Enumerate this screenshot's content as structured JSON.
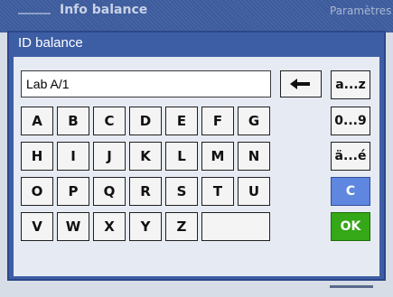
{
  "background": {
    "title_left": "Info balance",
    "title_right": "Paramètres"
  },
  "dialog": {
    "title": "ID balance",
    "input_value": "Lab A/1"
  },
  "keys": [
    [
      "A",
      "B",
      "C",
      "D",
      "E",
      "F",
      "G"
    ],
    [
      "H",
      "I",
      "J",
      "K",
      "L",
      "M",
      "N"
    ],
    [
      "O",
      "P",
      "Q",
      "R",
      "S",
      "T",
      "U"
    ],
    [
      "V",
      "W",
      "X",
      "Y",
      "Z"
    ]
  ],
  "side_buttons": {
    "lower_letters": "a...z",
    "digits": "0...9",
    "accents": "ä...é",
    "clear": "C",
    "ok": "OK"
  },
  "icons": {
    "backspace": "arrow-left-icon"
  },
  "colors": {
    "title_bar": "#3c5b9c",
    "panel": "#e6eaf3",
    "clear_button": "#5f87e0",
    "ok_button": "#34a816"
  }
}
